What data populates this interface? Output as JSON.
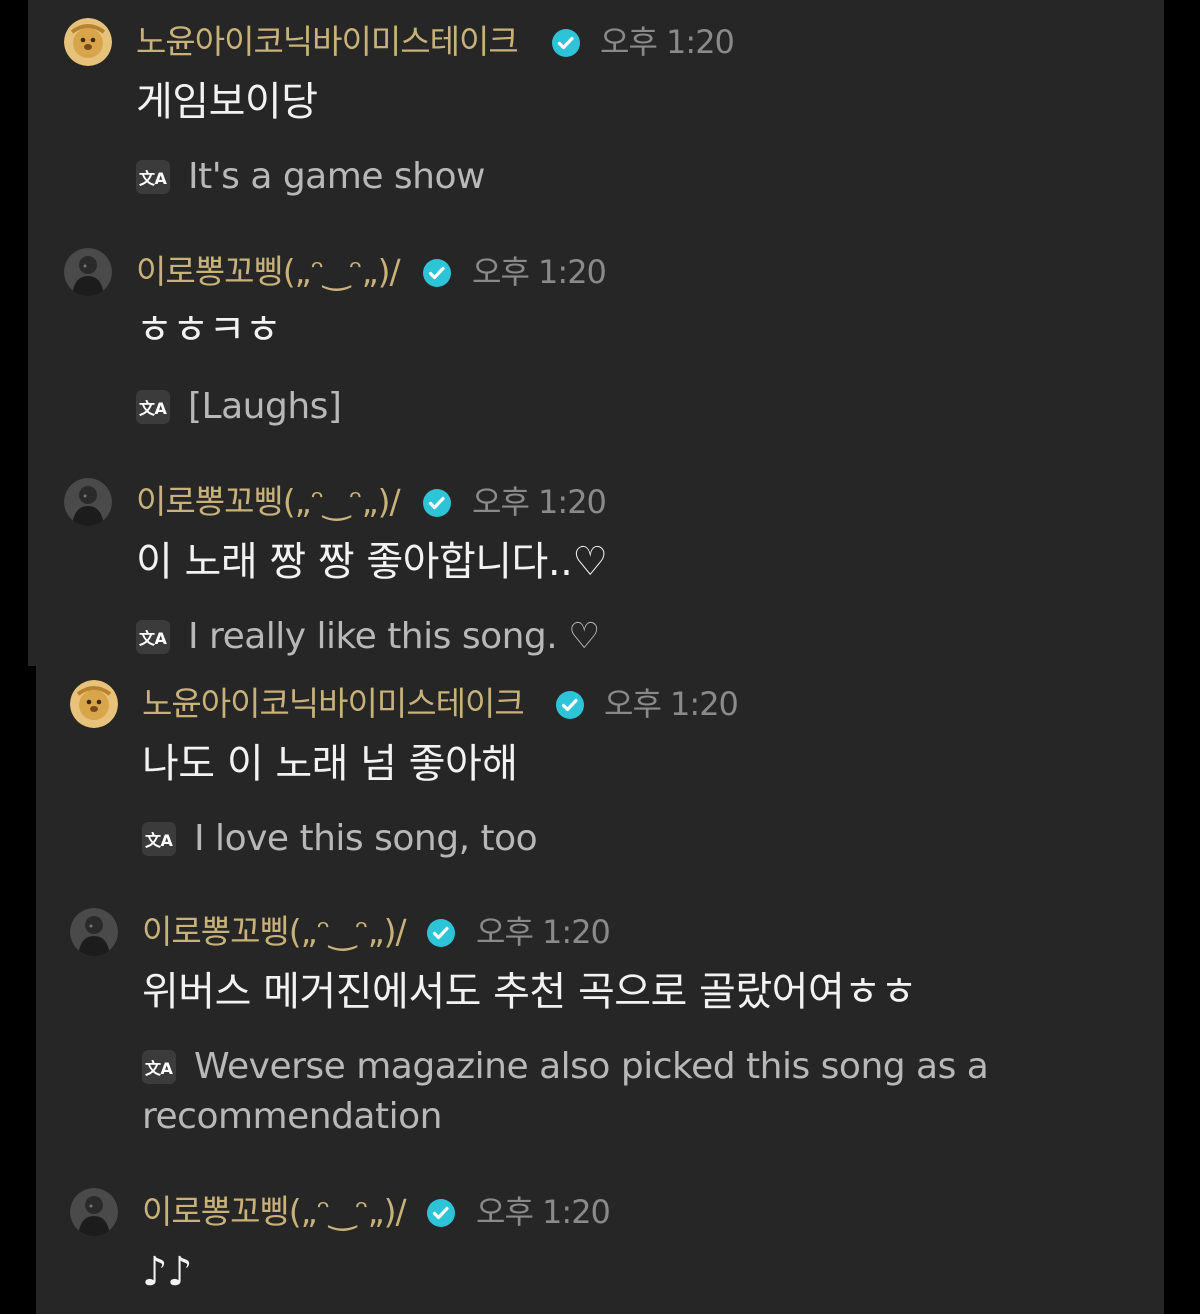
{
  "messages": [
    {
      "user": "노윤아이코닉바이미스테이크",
      "avatar": "lion-avatar",
      "verified": true,
      "time": "오후 1:20",
      "text": "게임보이당",
      "translation": "It's a game show"
    },
    {
      "user": "이로뽕꼬삥(„ᵔ‿ᵔ„)/",
      "avatar": "dark-photo-avatar",
      "verified": true,
      "time": "오후 1:20",
      "text": "ㅎㅎㅋㅎ",
      "translation": "[Laughs]"
    },
    {
      "user": "이로뽕꼬삥(„ᵔ‿ᵔ„)/",
      "avatar": "dark-photo-avatar",
      "verified": true,
      "time": "오후 1:20",
      "text": "이 노래 짱 짱 좋아합니다..♡",
      "translation": "I really like this song. ♡"
    },
    {
      "user": "노윤아이코닉바이미스테이크",
      "avatar": "lion-avatar",
      "verified": true,
      "time": "오후 1:20",
      "text": "나도 이 노래 넘 좋아해",
      "translation": "I love this song, too"
    },
    {
      "user": "이로뽕꼬삥(„ᵔ‿ᵔ„)/",
      "avatar": "dark-photo-avatar",
      "verified": true,
      "time": "오후 1:20",
      "text": "위버스 메거진에서도 추천 곡으로 골랐어여ㅎㅎ",
      "translation_line1": "Weverse magazine also picked this song as a",
      "translation_line2": "recommendation"
    },
    {
      "user": "이로뽕꼬삥(„ᵔ‿ᵔ„)/",
      "avatar": "dark-photo-avatar",
      "verified": true,
      "time": "오후 1:20",
      "text": "♪♪"
    }
  ],
  "colors": {
    "background": "#262626",
    "username": "#c9b27a",
    "verified_badge": "#2ec4d8",
    "timestamp": "#8a8a8a",
    "message_text": "#f2f2f2",
    "translation_text": "#b8b8b8"
  },
  "icons": {
    "verified": "verified-badge-icon",
    "translate": "translate-icon"
  }
}
